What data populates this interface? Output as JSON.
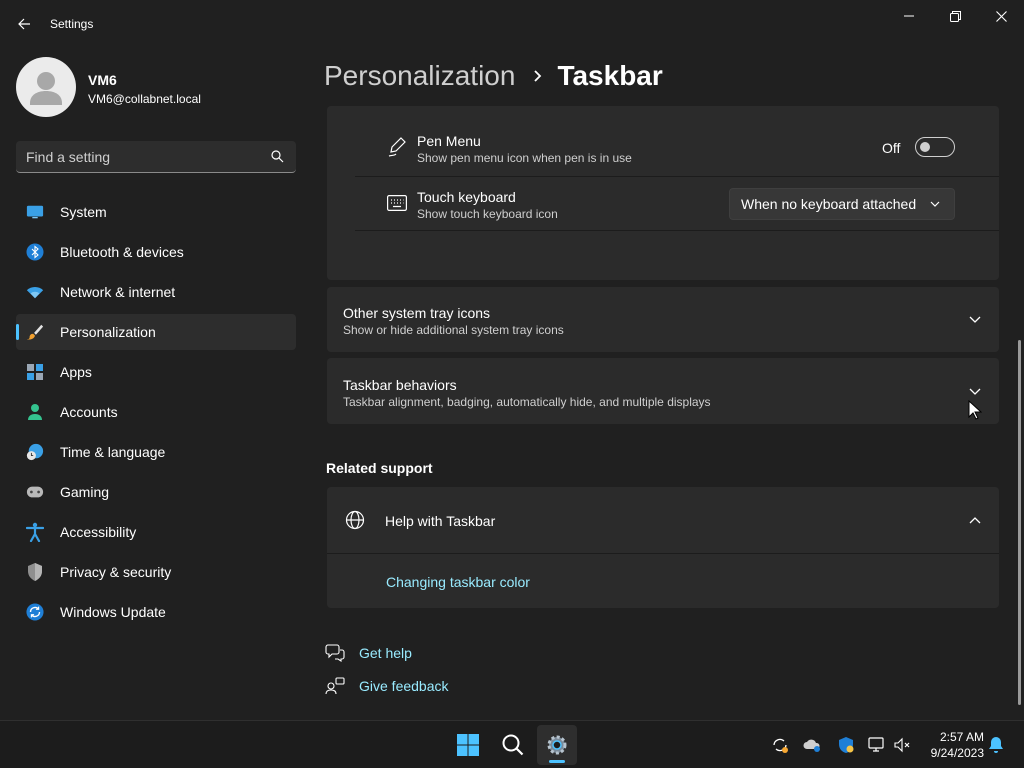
{
  "app": {
    "title": "Settings"
  },
  "user": {
    "name": "VM6",
    "email": "VM6@collabnet.local"
  },
  "search": {
    "placeholder": "Find a setting"
  },
  "nav": {
    "items": [
      {
        "label": "System",
        "icon": "system-icon"
      },
      {
        "label": "Bluetooth & devices",
        "icon": "bluetooth-icon"
      },
      {
        "label": "Network & internet",
        "icon": "wifi-icon"
      },
      {
        "label": "Personalization",
        "icon": "brush-icon",
        "active": true
      },
      {
        "label": "Apps",
        "icon": "apps-icon"
      },
      {
        "label": "Accounts",
        "icon": "accounts-icon"
      },
      {
        "label": "Time & language",
        "icon": "globe-clock-icon"
      },
      {
        "label": "Gaming",
        "icon": "gamepad-icon"
      },
      {
        "label": "Accessibility",
        "icon": "accessibility-icon"
      },
      {
        "label": "Privacy & security",
        "icon": "shield-icon"
      },
      {
        "label": "Windows Update",
        "icon": "update-icon"
      }
    ]
  },
  "breadcrumb": {
    "parent": "Personalization",
    "current": "Taskbar"
  },
  "main": {
    "pen_menu": {
      "title": "Pen Menu",
      "subtitle": "Show pen menu icon when pen is in use",
      "state_label": "Off",
      "enabled": false
    },
    "touch_keyboard": {
      "title": "Touch keyboard",
      "subtitle": "Show touch keyboard icon",
      "selected": "When no keyboard attached"
    },
    "other_tray": {
      "title": "Other system tray icons",
      "subtitle": "Show or hide additional system tray icons"
    },
    "behaviors": {
      "title": "Taskbar behaviors",
      "subtitle": "Taskbar alignment, badging, automatically hide, and multiple displays"
    },
    "related_support": {
      "title": "Related support",
      "help_title": "Help with Taskbar",
      "link": "Changing taskbar color"
    },
    "footer_links": {
      "get_help": "Get help",
      "give_feedback": "Give feedback"
    }
  },
  "taskbar": {
    "time": "2:57 AM",
    "date": "9/24/2023"
  },
  "colors": {
    "accent": "#4cc2ff",
    "link": "#99ebff",
    "background": "#202020",
    "card": "#2b2b2b"
  }
}
